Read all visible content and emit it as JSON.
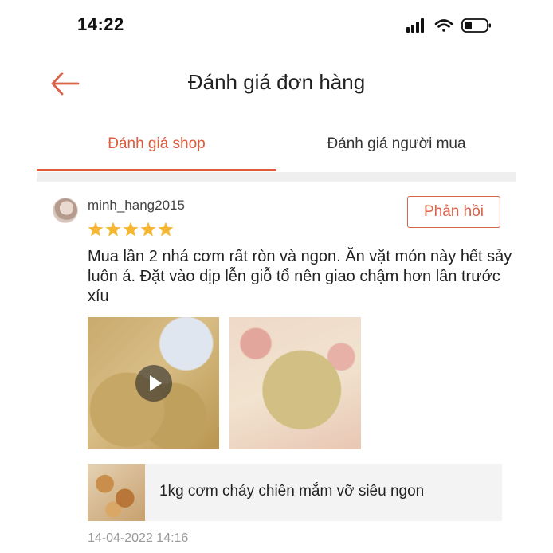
{
  "status_bar": {
    "time": "14:22",
    "icons": [
      "signal-icon",
      "wifi-icon",
      "battery-icon"
    ]
  },
  "header": {
    "title": "Đánh giá đơn hàng",
    "back_icon": "back-arrow-icon"
  },
  "tabs": [
    {
      "label": "Đánh giá shop",
      "active": true
    },
    {
      "label": "Đánh giá người mua",
      "active": false
    }
  ],
  "review": {
    "username": "minh_hang2015",
    "rating": 5,
    "reply_label": "Phản hồi",
    "text": "Mua lần 2 nhá cơm rất ròn và ngon. Ăn vặt món này hết sảy luôn á. Đặt vào dịp lễn giỗ tổ nên giao chậm hơn lần trước xíu",
    "media": [
      {
        "type": "video",
        "icon": "play-icon"
      },
      {
        "type": "image"
      }
    ],
    "product_name": "1kg cơm cháy chiên mắm vỡ siêu ngon",
    "timestamp": "14-04-2022 14:16"
  },
  "colors": {
    "accent": "#e05a3b",
    "star": "#f5b731",
    "divider": "#efefef",
    "muted_text": "#999999"
  }
}
